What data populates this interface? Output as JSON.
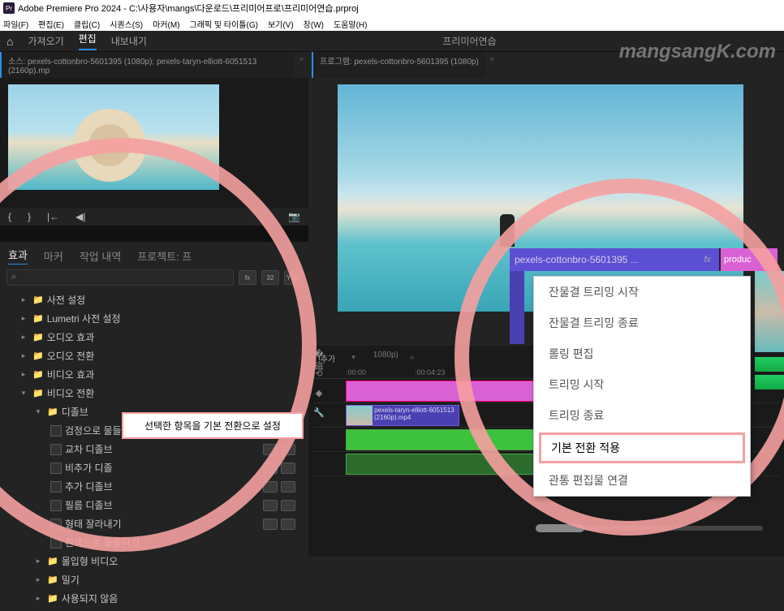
{
  "titlebar": {
    "app_badge": "Pr",
    "title": "Adobe Premiere Pro 2024 - C:\\사용자\\mangs\\다운로드\\프리미어프로\\프리미어연습.prproj"
  },
  "menubar": {
    "items": [
      "파일(F)",
      "편집(E)",
      "클립(C)",
      "시퀀스(S)",
      "마커(M)",
      "그래픽 및 타이틀(G)",
      "보기(V)",
      "창(W)",
      "도움말(H)"
    ]
  },
  "workspacebar": {
    "items": [
      "가져오기",
      "편집",
      "내보내기"
    ],
    "active_index": 1,
    "project_label": "프리미어연습"
  },
  "source_tab": "소스: pexels-cottonbro-5601395 (1080p); pexels-taryn-elliott-6051513 (2160p).mp",
  "program_tab": "프로그램: pexels-cottonbro-5601395 (1080p)",
  "effects_tabs": {
    "items": [
      "효과",
      "마커",
      "작업 내역",
      "프로젝트: 프"
    ],
    "active_index": 0
  },
  "search": {
    "placeholder": ""
  },
  "filter_buttons": [
    "fx",
    "32",
    "YUV"
  ],
  "tree": [
    {
      "level": 1,
      "exp": "closed",
      "icon": "folder",
      "label": "사전 설정"
    },
    {
      "level": 1,
      "exp": "closed",
      "icon": "folder",
      "label": "Lumetri 사전 설정"
    },
    {
      "level": 1,
      "exp": "closed",
      "icon": "folder",
      "label": "오디오 효과"
    },
    {
      "level": 1,
      "exp": "closed",
      "icon": "folder",
      "label": "오디오 전환"
    },
    {
      "level": 1,
      "exp": "closed",
      "icon": "folder",
      "label": "비디오 효과"
    },
    {
      "level": 1,
      "exp": "open",
      "icon": "folder",
      "label": "비디오 전환"
    },
    {
      "level": 2,
      "exp": "open",
      "icon": "folder",
      "label": "디졸브"
    },
    {
      "level": 3,
      "exp": "",
      "icon": "fx",
      "label": "검정으로 물들이기",
      "btns": true
    },
    {
      "level": 3,
      "exp": "",
      "icon": "fx",
      "label": "교차 디졸브",
      "btns": true
    },
    {
      "level": 3,
      "exp": "",
      "icon": "fx",
      "label": "비추가 디졸",
      "btns": true
    },
    {
      "level": 3,
      "exp": "",
      "icon": "fx",
      "label": "추가 디졸브",
      "btns": true
    },
    {
      "level": 3,
      "exp": "",
      "icon": "fx",
      "label": "필름 디졸브",
      "btns": true
    },
    {
      "level": 3,
      "exp": "",
      "icon": "fx",
      "label": "형태 잘라내기",
      "btns": true
    },
    {
      "level": 3,
      "exp": "",
      "icon": "fx",
      "label": "흰색으로 물들이기"
    },
    {
      "level": 2,
      "exp": "closed",
      "icon": "folder",
      "label": "몰입형 비디오"
    },
    {
      "level": 2,
      "exp": "closed",
      "icon": "folder",
      "label": "밀기"
    },
    {
      "level": 2,
      "exp": "closed",
      "icon": "folder",
      "label": "사용되지 않음"
    }
  ],
  "callout_left": "선택한 항목을 기본 전환으로 설정",
  "context_menu": {
    "items": [
      "잔물결 트리밍 시작",
      "잔물결 트리밍 종료",
      "롤링 편집",
      "트리밍 시작",
      "트리밍 종료",
      "기본 전환 적용",
      "관통 편집물 연결"
    ],
    "highlight_index": 5
  },
  "clip_strip": {
    "purple_label": "pexels-cottonbro-5601395 ...",
    "fx_label": "fx",
    "pink_label": "produc"
  },
  "timeline": {
    "seq_label": "!추가",
    "ruler": [
      ":00:00",
      ":00:04:23"
    ],
    "video_clip_label": "pexels-taryn-elliott-6051513 (2160p).mp4",
    "program_tab_small": "1080p)"
  },
  "watermark": "mangsangK.com"
}
